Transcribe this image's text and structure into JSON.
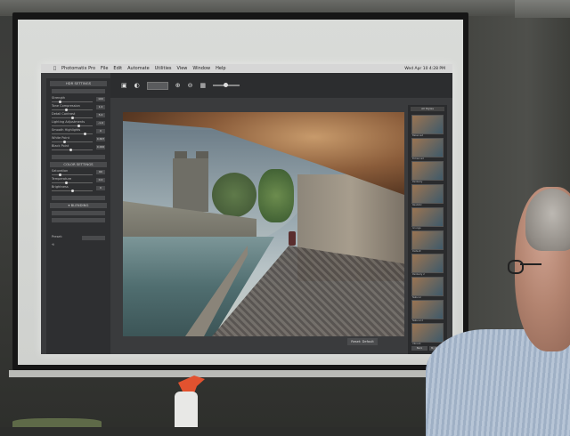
{
  "app": {
    "name": "Photomatix Pro",
    "menu": [
      "Photomatix Pro",
      "File",
      "Edit",
      "Automate",
      "Utilities",
      "View",
      "Window",
      "Help"
    ],
    "clock": "Wed Apr 10 4:28 PM"
  },
  "left_panel": {
    "hdr_settings": "HDR SETTINGS",
    "params": [
      {
        "label": "Strength",
        "value": "100"
      },
      {
        "label": "Tone Compression",
        "value": "1.0"
      },
      {
        "label": "Detail Contrast",
        "value": "5.0"
      },
      {
        "label": "Lighting Adjustments",
        "value": "-1.0"
      },
      {
        "label": "Smooth Highlights",
        "value": "0"
      },
      {
        "label": "White Point",
        "value": "0.667"
      },
      {
        "label": "Black Point",
        "value": "0.000"
      }
    ],
    "color_settings": "COLOR SETTINGS",
    "color_params": [
      {
        "label": "Saturation",
        "value": "60"
      },
      {
        "label": "Temperature",
        "value": "0.0"
      },
      {
        "label": "Brightness",
        "value": "0"
      }
    ],
    "blending": "▾ BLENDING",
    "preset_label": "Preset:"
  },
  "right_panel": {
    "header": "All Styles",
    "thumbs": [
      "Balanced",
      "Enhanced",
      "Painterly",
      "Realistic",
      "Grunge",
      "Default",
      "Painterly 2",
      "Natural",
      "Natural 2",
      "Vibrant"
    ],
    "buttons": [
      "Back",
      "My Presets"
    ]
  },
  "photo_button": "Reset: Default",
  "colors": {
    "projector_bg": "#3a3b3d",
    "sweater": "#b7c5d6",
    "sprayer": "#e2522f"
  }
}
